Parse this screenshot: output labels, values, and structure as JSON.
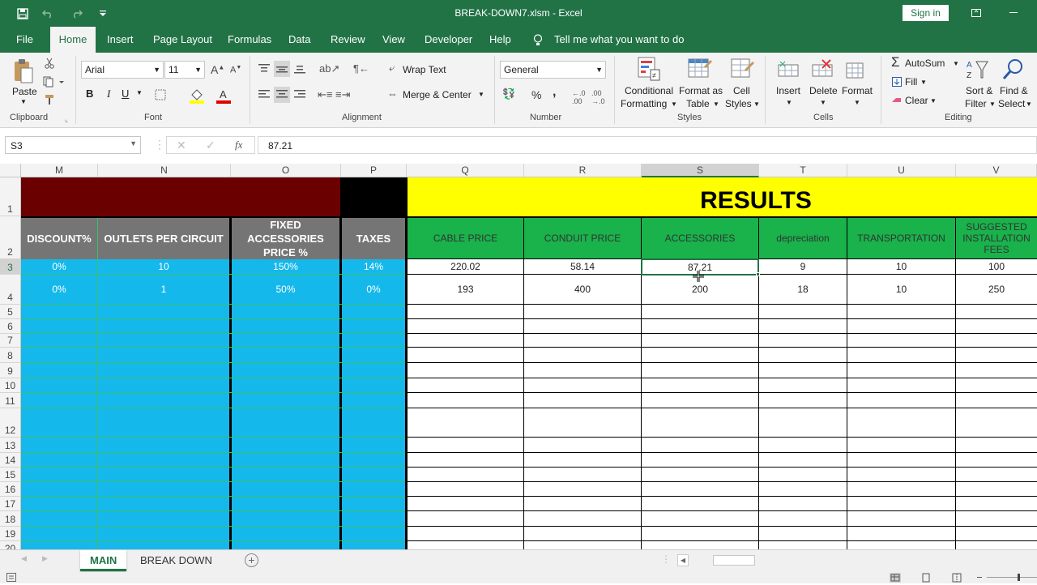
{
  "window": {
    "title": "BREAK-DOWN7.xlsm  -  Excel",
    "sign_in": "Sign in"
  },
  "menu_tabs": [
    "File",
    "Home",
    "Insert",
    "Page Layout",
    "Formulas",
    "Data",
    "Review",
    "View",
    "Developer",
    "Help"
  ],
  "tell_me": "Tell me what you want to do",
  "ribbon": {
    "clipboard": {
      "label": "Clipboard",
      "paste": "Paste"
    },
    "font": {
      "label": "Font",
      "name": "Arial",
      "size": "11",
      "bold": "B",
      "italic": "I",
      "underline": "U"
    },
    "alignment": {
      "label": "Alignment",
      "wrap": "Wrap Text",
      "merge": "Merge & Center"
    },
    "number": {
      "label": "Number",
      "format": "General",
      "percent": "%",
      "comma": ","
    },
    "styles": {
      "label": "Styles",
      "cond1": "Conditional",
      "cond2": "Formatting",
      "fmt1": "Format as",
      "fmt2": "Table",
      "cell1": "Cell",
      "cell2": "Styles"
    },
    "cells": {
      "label": "Cells",
      "insert": "Insert",
      "delete": "Delete",
      "format": "Format"
    },
    "editing": {
      "label": "Editing",
      "autosum": "AutoSum",
      "fill": "Fill",
      "clear": "Clear",
      "sort1": "Sort &",
      "sort2": "Filter",
      "find1": "Find &",
      "find2": "Select"
    }
  },
  "formula_bar": {
    "name_box": "S3",
    "value": "87.21",
    "fx": "fx"
  },
  "columns": [
    "M",
    "N",
    "O",
    "P",
    "Q",
    "R",
    "S",
    "T",
    "U",
    "V"
  ],
  "rows": [
    "1",
    "2",
    "3",
    "4",
    "5",
    "6",
    "7",
    "8",
    "9",
    "10",
    "11",
    "12",
    "13",
    "14",
    "15",
    "16",
    "17",
    "18",
    "19",
    "20"
  ],
  "results_title": "RESULTS",
  "headers": {
    "M": "DISCOUNT%",
    "N": "OUTLETS PER CIRCUIT",
    "O": "FIXED ACCESSORIES PRICE %",
    "P": "TAXES",
    "Q": "CABLE PRICE",
    "R": "CONDUIT PRICE",
    "S": "ACCESSORIES",
    "T": "depreciation",
    "U": "TRANSPORTATION",
    "V": "SUGGESTED INSTALLATION FEES"
  },
  "row3": {
    "M": "0%",
    "N": "10",
    "O": "150%",
    "P": "14%",
    "Q": "220.02",
    "R": "58.14",
    "S": "87.21",
    "T": "9",
    "U": "10",
    "V": "100"
  },
  "row4": {
    "M": "0%",
    "N": "1",
    "O": "50%",
    "P": "0%",
    "Q": "193",
    "R": "400",
    "S": "200",
    "T": "18",
    "U": "10",
    "V": "250"
  },
  "sheets": [
    "MAIN",
    "BREAK DOWN"
  ],
  "active_sheet": "MAIN",
  "colors": {
    "excel_green": "#217346",
    "dark_red": "#6b0000",
    "header_gray": "#757575",
    "input_blue": "#15b8ea",
    "results_green": "#19b24b",
    "results_yellow": "#ffff00"
  }
}
